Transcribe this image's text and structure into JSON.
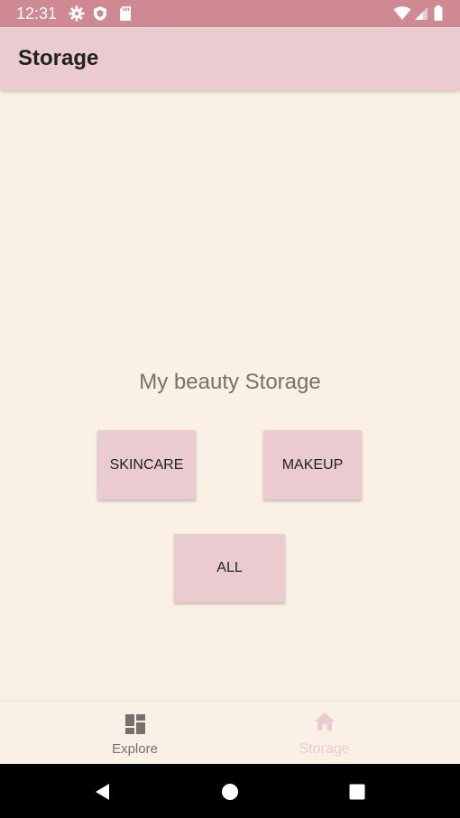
{
  "status_bar": {
    "time": "12:31",
    "icons": [
      "gear-icon",
      "shield-icon",
      "sd-card-icon",
      "wifi-icon",
      "signal-icon",
      "battery-icon"
    ],
    "color": "#cf8992"
  },
  "app_bar": {
    "title": "Storage",
    "color": "#eacbcf"
  },
  "main": {
    "heading": "My beauty Storage",
    "buttons": {
      "skincare": "SKINCARE",
      "makeup": "MAKEUP",
      "all": "ALL"
    },
    "background": "#faf0e6",
    "button_color": "#eacbcf"
  },
  "bottom_nav": {
    "items": [
      {
        "label": "Explore",
        "icon": "dashboard-icon",
        "state": "inactive"
      },
      {
        "label": "Storage",
        "icon": "home-icon",
        "state": "selected"
      }
    ]
  },
  "system_nav": {
    "icons": [
      "back-icon",
      "home-circle-icon",
      "recents-icon"
    ]
  }
}
